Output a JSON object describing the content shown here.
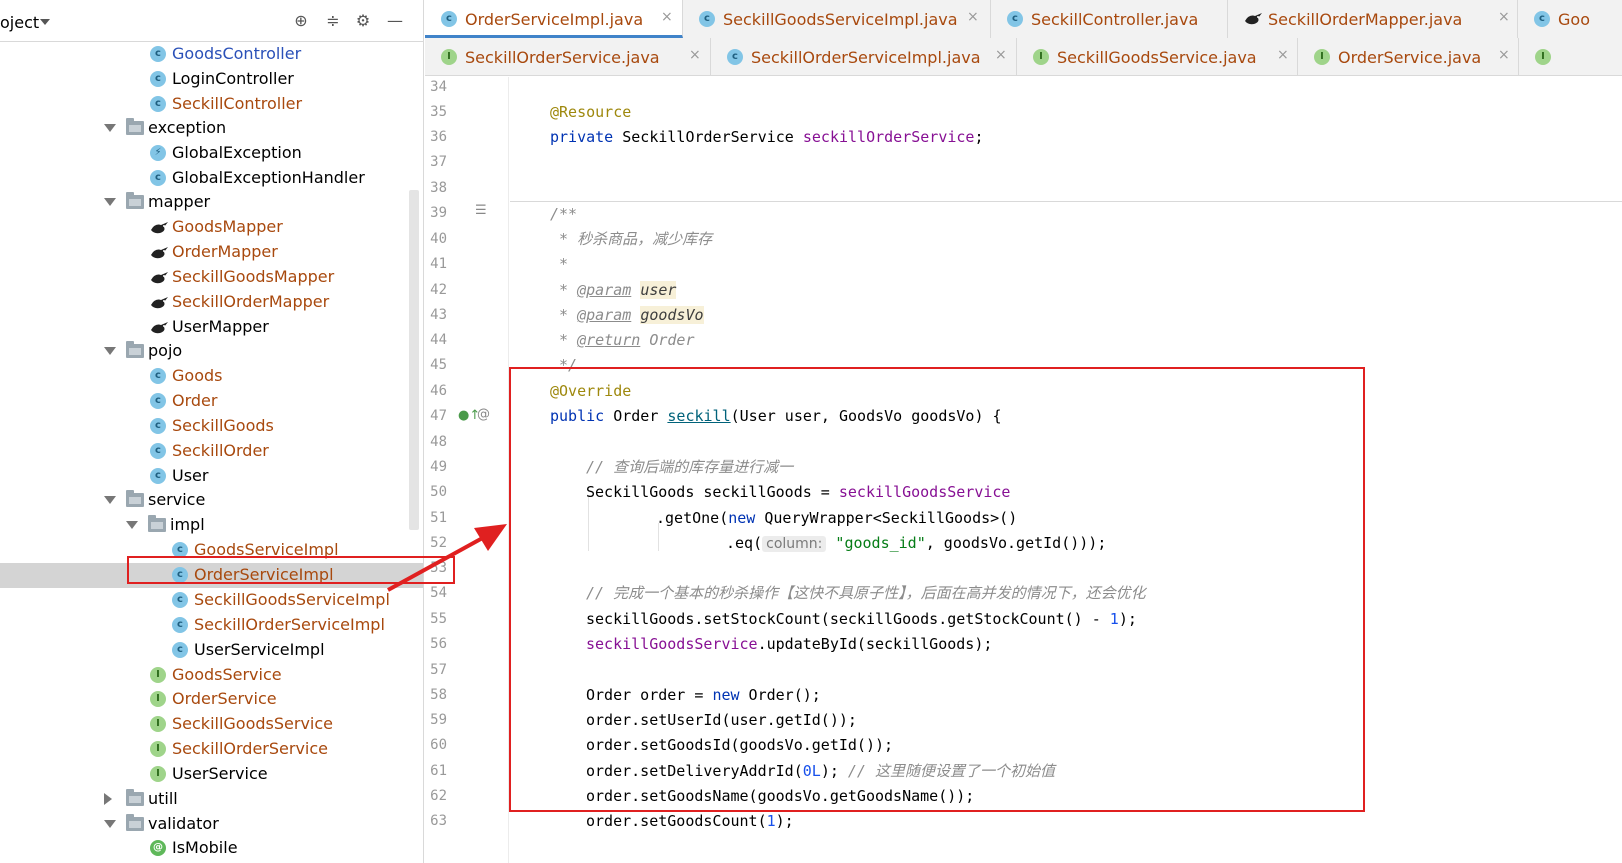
{
  "project": {
    "title": "oject",
    "tree": [
      {
        "label": "GoodsController",
        "icon": "class",
        "color": "blue"
      },
      {
        "label": "LoginController",
        "icon": "class",
        "color": "black"
      },
      {
        "label": "SeckillController",
        "icon": "class",
        "color": "brown"
      },
      {
        "label": "exception",
        "icon": "folder",
        "color": "black"
      },
      {
        "label": "GlobalException",
        "icon": "exception-class",
        "color": "black"
      },
      {
        "label": "GlobalExceptionHandler",
        "icon": "class",
        "color": "black"
      },
      {
        "label": "mapper",
        "icon": "folder",
        "color": "black"
      },
      {
        "label": "GoodsMapper",
        "icon": "mybatis",
        "color": "brown"
      },
      {
        "label": "OrderMapper",
        "icon": "mybatis",
        "color": "brown"
      },
      {
        "label": "SeckillGoodsMapper",
        "icon": "mybatis",
        "color": "brown"
      },
      {
        "label": "SeckillOrderMapper",
        "icon": "mybatis",
        "color": "brown"
      },
      {
        "label": "UserMapper",
        "icon": "mybatis",
        "color": "black"
      },
      {
        "label": "pojo",
        "icon": "folder",
        "color": "black"
      },
      {
        "label": "Goods",
        "icon": "class",
        "color": "brown"
      },
      {
        "label": "Order",
        "icon": "class",
        "color": "brown"
      },
      {
        "label": "SeckillGoods",
        "icon": "class",
        "color": "brown"
      },
      {
        "label": "SeckillOrder",
        "icon": "class",
        "color": "brown"
      },
      {
        "label": "User",
        "icon": "class",
        "color": "black"
      },
      {
        "label": "service",
        "icon": "folder",
        "color": "black"
      },
      {
        "label": "impl",
        "icon": "folder",
        "color": "black"
      },
      {
        "label": "GoodsServiceImpl",
        "icon": "class",
        "color": "brown"
      },
      {
        "label": "OrderServiceImpl",
        "icon": "class",
        "color": "brown"
      },
      {
        "label": "SeckillGoodsServiceImpl",
        "icon": "class",
        "color": "brown"
      },
      {
        "label": "SeckillOrderServiceImpl",
        "icon": "class",
        "color": "brown"
      },
      {
        "label": "UserServiceImpl",
        "icon": "class",
        "color": "black"
      },
      {
        "label": "GoodsService",
        "icon": "interface",
        "color": "brown"
      },
      {
        "label": "OrderService",
        "icon": "interface",
        "color": "brown"
      },
      {
        "label": "SeckillGoodsService",
        "icon": "interface",
        "color": "brown"
      },
      {
        "label": "SeckillOrderService",
        "icon": "interface",
        "color": "brown"
      },
      {
        "label": "UserService",
        "icon": "interface",
        "color": "black"
      },
      {
        "label": "utill",
        "icon": "folder",
        "color": "black"
      },
      {
        "label": "validator",
        "icon": "folder",
        "color": "black"
      },
      {
        "label": "IsMobile",
        "icon": "annotation",
        "color": "black"
      }
    ]
  },
  "tabs": {
    "row1": [
      {
        "label": "OrderServiceImpl.java",
        "icon": "class",
        "active": true
      },
      {
        "label": "SeckillGoodsServiceImpl.java",
        "icon": "class"
      },
      {
        "label": "SeckillController.java",
        "icon": "class"
      },
      {
        "label": "SeckillOrderMapper.java",
        "icon": "mybatis"
      },
      {
        "label": "Goo",
        "icon": "class"
      }
    ],
    "row2": [
      {
        "label": "SeckillOrderService.java",
        "icon": "interface"
      },
      {
        "label": "SeckillOrderServiceImpl.java",
        "icon": "class"
      },
      {
        "label": "SeckillGoodsService.java",
        "icon": "interface"
      },
      {
        "label": "OrderService.java",
        "icon": "interface"
      },
      {
        "label": "",
        "icon": "interface"
      }
    ]
  },
  "editor": {
    "line_numbers": [
      "34",
      "35",
      "36",
      "37",
      "38",
      "39",
      "40",
      "41",
      "42",
      "43",
      "44",
      "45",
      "46",
      "47",
      "48",
      "49",
      "50",
      "51",
      "52",
      "53",
      "54",
      "55",
      "56",
      "57",
      "58",
      "59",
      "60",
      "61",
      "62",
      "63"
    ],
    "code": {
      "l35_anno": "@Resource",
      "l36_kw": "private",
      "l36_type": " SeckillOrderService ",
      "l36_field": "seckillOrderService",
      "l36_end": ";",
      "l39": "/**",
      "l40": " * 秒杀商品，减少库存",
      "l41": " *",
      "l42_star": " * ",
      "l42_tag": "@param",
      "l42_p": "user",
      "l43_star": " * ",
      "l43_tag": "@param",
      "l43_p": "goodsVo",
      "l44_star": " * ",
      "l44_tag": "@return",
      "l44_p": " Order",
      "l45": " */",
      "l46_anno": "@Override",
      "l47_kw": "public",
      "l47_type": " Order ",
      "l47_meth": "seckill",
      "l47_rest": "(User user, GoodsVo goodsVo) {",
      "l49": "// 查询后端的库存量进行减一",
      "l50_a": "SeckillGoods seckillGoods = ",
      "l50_field": "seckillGoodsService",
      "l51_a": ".getOne(",
      "l51_kw": "new",
      "l51_b": " QueryWrapper<SeckillGoods>()",
      "l52_a": ".eq(",
      "l52_hint": "column:",
      "l52_str": "\"goods_id\"",
      "l52_b": ", goodsVo.getId()));",
      "l54": "// 完成一个基本的秒杀操作【这快不具原子性】，后面在高并发的情况下，还会优化",
      "l55_a": "seckillGoods.setStockCount(seckillGoods.getStockCount() - ",
      "l55_num": "1",
      "l55_b": ");",
      "l56_field": "seckillGoodsService",
      "l56_b": ".updateById(seckillGoods);",
      "l58_a": "Order order = ",
      "l58_kw": "new",
      "l58_b": " Order();",
      "l59": "order.setUserId(user.getId());",
      "l60": "order.setGoodsId(goodsVo.getId());",
      "l61_a": "order.setDeliveryAddrId(",
      "l61_num": "0L",
      "l61_b": "); ",
      "l61_cmt": "// 这里随便设置了一个初始值",
      "l62": "order.setGoodsName(goodsVo.getGoodsName());",
      "l63_a": "order.setGoodsCount(",
      "l63_num": "1",
      "l63_b": ");"
    }
  },
  "colors": {
    "highlight": "#e02020",
    "keyword": "#0033b3",
    "annotation": "#9e880d",
    "field": "#871094",
    "comment": "#8c8c8c"
  }
}
